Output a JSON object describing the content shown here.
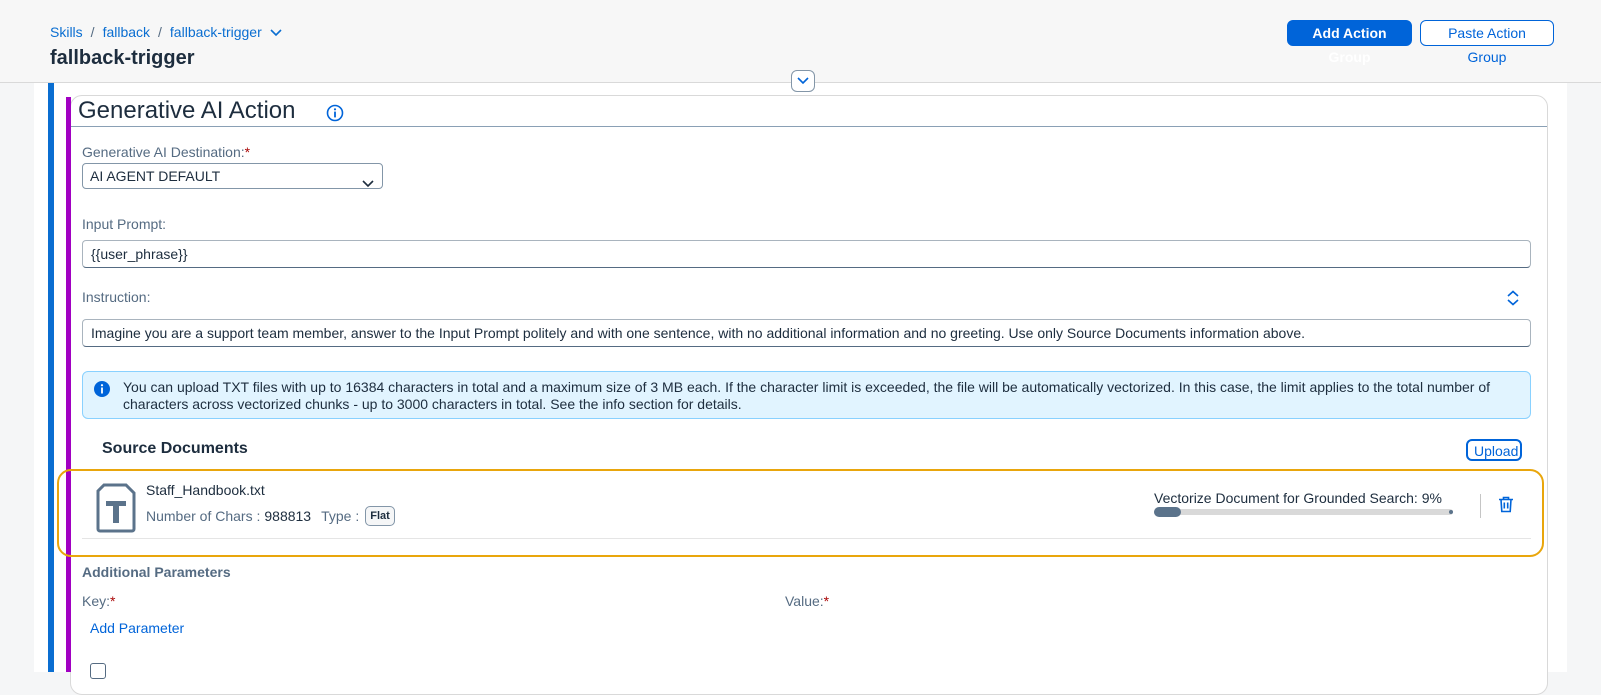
{
  "header": {
    "breadcrumb": [
      "Skills",
      "fallback",
      "fallback-trigger"
    ],
    "title": "fallback-trigger",
    "add_action_group": "Add Action Group",
    "paste_action_group": "Paste Action Group"
  },
  "action": {
    "title": "Generative AI Action",
    "destination_label": "Generative AI Destination:",
    "required_mark": "*",
    "destination_value": "AI AGENT DEFAULT",
    "input_prompt_label": "Input Prompt:",
    "input_prompt_value": "{{user_phrase}}",
    "instruction_label": "Instruction:",
    "instruction_value": "Imagine you are a support team member, answer to the Input Prompt politely and with one sentence, with no additional information and no greeting. Use only Source Documents information above.",
    "info_text": "You can upload TXT files with up to 16384 characters in total and a maximum size of 3 MB each. If the character limit is exceeded, the file will be automatically vectorized. In this case, the limit applies to the total number of characters across vectorized chunks - up to 3000 characters in total. See the info section for details."
  },
  "source_documents": {
    "title": "Source Documents",
    "upload_label": "Upload",
    "documents": [
      {
        "name": "Staff_Handbook.txt",
        "chars_label": "Number of Chars :",
        "chars_value": "988813",
        "type_label": "Type :",
        "type_value": "Flat",
        "vectorize_label": "Vectorize Document for Grounded Search: 9%",
        "progress": 0.09
      }
    ]
  },
  "additional_parameters": {
    "title": "Additional Parameters",
    "key_label": "Key:",
    "value_label": "Value:",
    "add_parameter": "Add Parameter"
  },
  "colors": {
    "accent": "#0064d9",
    "purple_bar": "#a100c2",
    "highlight": "#e9a60c"
  }
}
